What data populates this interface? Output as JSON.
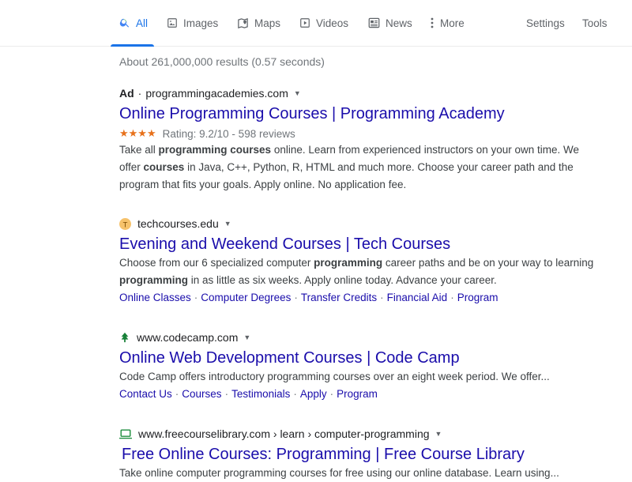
{
  "tabs": [
    {
      "label": "All",
      "icon": "search-icon",
      "active": true
    },
    {
      "label": "Images",
      "icon": "image-icon"
    },
    {
      "label": "Maps",
      "icon": "map-icon"
    },
    {
      "label": "Videos",
      "icon": "video-icon"
    },
    {
      "label": "News",
      "icon": "news-icon"
    },
    {
      "label": "More",
      "icon": "more-vert-icon"
    }
  ],
  "tools": {
    "settings": "Settings",
    "tools": "Tools"
  },
  "stats": "About 261,000,000 results (0.57 seconds)",
  "results": [
    {
      "ad_label": "Ad",
      "url": "programmingacademies.com",
      "title": "Online Programming Courses | Programming Academy",
      "stars": "★★★★",
      "rating": "Rating: 9.2/10 - 598 reviews",
      "snippet": [
        {
          "t": "Take all "
        },
        {
          "t": "programming courses",
          "b": true
        },
        {
          "t": " online. Learn from experienced instructors on your own time. We offer "
        },
        {
          "t": "courses",
          "b": true
        },
        {
          "t": " in Java, C++, Python, R, HTML and much more. Choose your career path and the program that fits your goals. Apply online. No application fee."
        }
      ]
    },
    {
      "favicon_letter": "T",
      "favicon_color": "#f6c26b",
      "url": "techcourses.edu",
      "title": "Evening and Weekend Courses | Tech Courses",
      "snippet": [
        {
          "t": "Choose from our 6 specialized computer "
        },
        {
          "t": "programming",
          "b": true
        },
        {
          "t": " career paths and be on your way to learning "
        },
        {
          "t": "programming",
          "b": true
        },
        {
          "t": " in as little as six weeks. Apply online today. Advance your career."
        }
      ],
      "sitelinks": [
        "Online Classes",
        "Computer Degrees",
        "Transfer Credits",
        "Financial Aid",
        "Program"
      ]
    },
    {
      "favicon_icon": "tree-icon",
      "favicon_color": "#188038",
      "url": "www.codecamp.com",
      "title": "Online Web Development Courses | Code Camp",
      "snippet": [
        {
          "t": "Code Camp offers introductory programming courses over an eight week period. We offer..."
        }
      ],
      "sitelinks": [
        "Contact Us",
        "Courses",
        "Testimonials",
        "Apply",
        "Program"
      ]
    },
    {
      "favicon_icon": "laptop-icon",
      "favicon_color": "#1e8e3e",
      "url": "www.freecourselibrary.com › learn › computer-programming",
      "title": "Free Online Courses: Programming | Free Course Library",
      "snippet": [
        {
          "t": "Take online computer programming courses for free using our online database. Learn using..."
        }
      ]
    }
  ],
  "colors": {
    "link": "#1a0dab",
    "accent": "#1a73e8",
    "star": "#e7711b"
  }
}
